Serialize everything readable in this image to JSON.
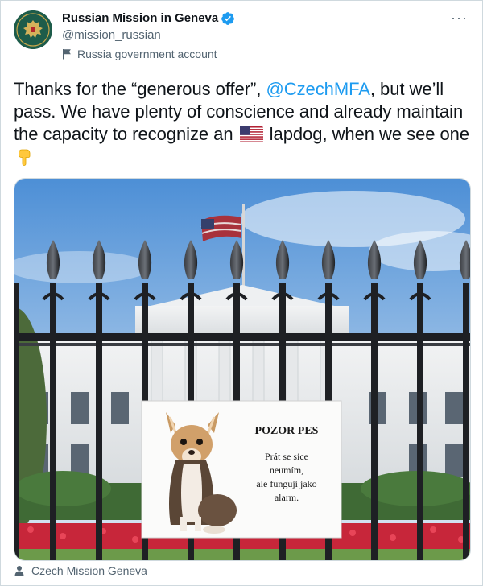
{
  "account": {
    "display_name": "Russian Mission in Geneva",
    "handle": "@mission_russian",
    "label": "Russia government account",
    "verified": true
  },
  "tweet": {
    "text_before_mention": "Thanks for the “generous offer”, ",
    "mention": "@CzechMFA",
    "text_after_mention": ", but we’ll pass. We have plenty of conscience and already maintain the capacity to recognize an ",
    "text_after_flag": " lapdog, when we see one",
    "emojis": [
      "us-flag-emoji",
      "backhand-index-pointing-down-emoji"
    ]
  },
  "media": {
    "sign_title": "POZOR PES",
    "sign_line1": "Prát se sice",
    "sign_line2": "neumím,",
    "sign_line3": "ale funguji jako",
    "sign_line4": "alarm.",
    "credit": "Czech Mission Geneva"
  },
  "icons": {
    "more": "more-icon",
    "verified": "verified-badge-icon",
    "gov_label": "flag-icon",
    "credit": "person-icon"
  },
  "colors": {
    "link": "#1d9bf0",
    "verified": "#1d9bf0",
    "secondary_text": "#536471",
    "border": "#cfd9de"
  }
}
